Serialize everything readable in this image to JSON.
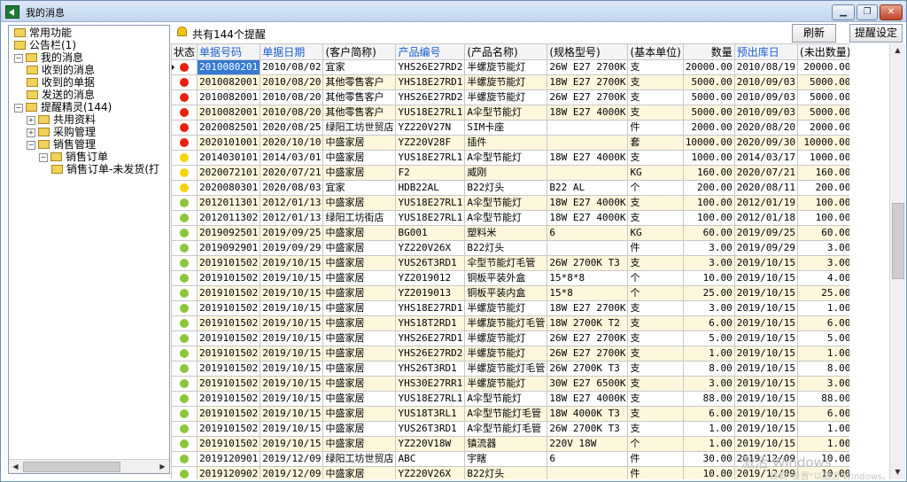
{
  "window": {
    "title": "我的消息",
    "minimize": "▁",
    "restore": "❐",
    "close": "✕"
  },
  "tree": {
    "nodes": [
      {
        "label": "常用功能",
        "level": 0,
        "expander": ""
      },
      {
        "label": "公告栏(1)",
        "level": 0,
        "expander": ""
      },
      {
        "label": "我的消息",
        "level": 0,
        "expander": "−"
      },
      {
        "label": "收到的消息",
        "level": 1,
        "expander": ""
      },
      {
        "label": "收到的单据",
        "level": 1,
        "expander": ""
      },
      {
        "label": "发送的消息",
        "level": 1,
        "expander": ""
      },
      {
        "label": "提醒精灵(144)",
        "level": 0,
        "expander": "−"
      },
      {
        "label": "共用资料",
        "level": 1,
        "expander": "+"
      },
      {
        "label": "采购管理",
        "level": 1,
        "expander": "+"
      },
      {
        "label": "销售管理",
        "level": 1,
        "expander": "−"
      },
      {
        "label": "销售订单",
        "level": 2,
        "expander": "−"
      },
      {
        "label": "销售订单-未发货(打",
        "level": 3,
        "expander": ""
      }
    ]
  },
  "toolbar": {
    "alert_count": "共有144个提醒",
    "refresh_label": "刷新",
    "settings_label": "提醒设定"
  },
  "table": {
    "headers": [
      "状态",
      "单据号码",
      "单据日期",
      "(客户简称)",
      "产品编号",
      "(产品名称)",
      "(规格型号)",
      "(基本单位)",
      "数量",
      "预出库日",
      "(未出数量)"
    ],
    "status_colors": {
      "red": "#e8200c",
      "yellow": "#f6d40c",
      "green": "#8cc63a"
    },
    "rows": [
      {
        "status": "red",
        "no": "2010080201",
        "date": "2010/08/02",
        "customer": "宜家",
        "code": "YHS26E27RD2",
        "name": "半螺旋节能灯",
        "spec": "26W E27 2700K",
        "unit": "支",
        "qty": "20000.00",
        "due": "2010/08/19",
        "pending": "20000.00"
      },
      {
        "status": "red",
        "no": "2010082001",
        "date": "2010/08/20",
        "customer": "其他零售客户",
        "code": "YHS18E27RD1",
        "name": "半螺旋节能灯",
        "spec": "18W E27 2700K",
        "unit": "支",
        "qty": "5000.00",
        "due": "2010/09/03",
        "pending": "5000.00"
      },
      {
        "status": "red",
        "no": "2010082001",
        "date": "2010/08/20",
        "customer": "其他零售客户",
        "code": "YHS26E27RD2",
        "name": "半螺旋节能灯",
        "spec": "26W E27 2700K",
        "unit": "支",
        "qty": "5000.00",
        "due": "2010/09/03",
        "pending": "5000.00"
      },
      {
        "status": "red",
        "no": "2010082001",
        "date": "2010/08/20",
        "customer": "其他零售客户",
        "code": "YUS18E27RL1",
        "name": "A伞型节能灯",
        "spec": "18W E27 4000K",
        "unit": "支",
        "qty": "5000.00",
        "due": "2010/09/03",
        "pending": "5000.00"
      },
      {
        "status": "red",
        "no": "2020082501",
        "date": "2020/08/25",
        "customer": "绿阳工坊世贸店",
        "code": "YZ220V27N",
        "name": "SIM卡座",
        "spec": "",
        "unit": "件",
        "qty": "2000.00",
        "due": "2020/08/20",
        "pending": "2000.00"
      },
      {
        "status": "red",
        "no": "2020101001",
        "date": "2020/10/10",
        "customer": "中盛家居",
        "code": "YZ220V28F",
        "name": "插件",
        "spec": "",
        "unit": "套",
        "qty": "10000.00",
        "due": "2020/09/30",
        "pending": "10000.00"
      },
      {
        "status": "yellow",
        "no": "2014030101",
        "date": "2014/03/01",
        "customer": "中盛家居",
        "code": "YUS18E27RL1",
        "name": "A伞型节能灯",
        "spec": "18W E27 4000K",
        "unit": "支",
        "qty": "1000.00",
        "due": "2014/03/17",
        "pending": "1000.00"
      },
      {
        "status": "yellow",
        "no": "2020072101",
        "date": "2020/07/21",
        "customer": "中盛家居",
        "code": "F2",
        "name": "威刚",
        "spec": "",
        "unit": "KG",
        "qty": "160.00",
        "due": "2020/07/21",
        "pending": "160.00"
      },
      {
        "status": "yellow",
        "no": "2020080301",
        "date": "2020/08/03",
        "customer": "宜家",
        "code": "HDB22AL",
        "name": "B22灯头",
        "spec": "B22 AL",
        "unit": "个",
        "qty": "200.00",
        "due": "2020/08/11",
        "pending": "200.00"
      },
      {
        "status": "green",
        "no": "2012011301",
        "date": "2012/01/13",
        "customer": "中盛家居",
        "code": "YUS18E27RL1",
        "name": "A伞型节能灯",
        "spec": "18W E27 4000K",
        "unit": "支",
        "qty": "100.00",
        "due": "2012/01/19",
        "pending": "100.00"
      },
      {
        "status": "green",
        "no": "2012011302",
        "date": "2012/01/13",
        "customer": "绿阳工坊街店",
        "code": "YUS18E27RL1",
        "name": "A伞型节能灯",
        "spec": "18W E27 4000K",
        "unit": "支",
        "qty": "100.00",
        "due": "2012/01/18",
        "pending": "100.00"
      },
      {
        "status": "green",
        "no": "2019092501",
        "date": "2019/09/25",
        "customer": "中盛家居",
        "code": "BG001",
        "name": "塑料米",
        "spec": "6",
        "unit": "KG",
        "qty": "60.00",
        "due": "2019/09/25",
        "pending": "60.00"
      },
      {
        "status": "green",
        "no": "2019092901",
        "date": "2019/09/29",
        "customer": "中盛家居",
        "code": "YZ220V26X",
        "name": "B22灯头",
        "spec": "",
        "unit": "件",
        "qty": "3.00",
        "due": "2019/09/29",
        "pending": "3.00"
      },
      {
        "status": "green",
        "no": "2019101502",
        "date": "2019/10/15",
        "customer": "中盛家居",
        "code": "YUS26T3RD1",
        "name": "伞型节能灯毛管",
        "spec": "26W 2700K T3",
        "unit": "支",
        "qty": "3.00",
        "due": "2019/10/15",
        "pending": "3.00"
      },
      {
        "status": "green",
        "no": "2019101502",
        "date": "2019/10/15",
        "customer": "中盛家居",
        "code": "YZ2019012",
        "name": "铜板平装外盒",
        "spec": "15*8*8",
        "unit": "个",
        "qty": "10.00",
        "due": "2019/10/15",
        "pending": "4.00"
      },
      {
        "status": "green",
        "no": "2019101502",
        "date": "2019/10/15",
        "customer": "中盛家居",
        "code": "YZ2019013",
        "name": "铜板平装内盒",
        "spec": "15*8",
        "unit": "个",
        "qty": "25.00",
        "due": "2019/10/15",
        "pending": "25.00"
      },
      {
        "status": "green",
        "no": "2019101502",
        "date": "2019/10/15",
        "customer": "中盛家居",
        "code": "YHS18E27RD1",
        "name": "半螺旋节能灯",
        "spec": "18W E27 2700K",
        "unit": "支",
        "qty": "3.00",
        "due": "2019/10/15",
        "pending": "1.00"
      },
      {
        "status": "green",
        "no": "2019101502",
        "date": "2019/10/15",
        "customer": "中盛家居",
        "code": "YHS18T2RD1",
        "name": "半螺旋节能灯毛管",
        "spec": "18W 2700K T2",
        "unit": "支",
        "qty": "6.00",
        "due": "2019/10/15",
        "pending": "6.00"
      },
      {
        "status": "green",
        "no": "2019101502",
        "date": "2019/10/15",
        "customer": "中盛家居",
        "code": "YHS26E27RD1",
        "name": "半螺旋节能灯",
        "spec": "26W E27 2700K",
        "unit": "支",
        "qty": "5.00",
        "due": "2019/10/15",
        "pending": "5.00"
      },
      {
        "status": "green",
        "no": "2019101502",
        "date": "2019/10/15",
        "customer": "中盛家居",
        "code": "YHS26E27RD2",
        "name": "半螺旋节能灯",
        "spec": "26W E27 2700K",
        "unit": "支",
        "qty": "1.00",
        "due": "2019/10/15",
        "pending": "1.00"
      },
      {
        "status": "green",
        "no": "2019101502",
        "date": "2019/10/15",
        "customer": "中盛家居",
        "code": "YHS26T3RD1",
        "name": "半螺旋节能灯毛管",
        "spec": "26W 2700K T3",
        "unit": "支",
        "qty": "8.00",
        "due": "2019/10/15",
        "pending": "8.00"
      },
      {
        "status": "green",
        "no": "2019101502",
        "date": "2019/10/15",
        "customer": "中盛家居",
        "code": "YHS30E27RR1",
        "name": "半螺旋节能灯",
        "spec": "30W E27 6500K",
        "unit": "支",
        "qty": "3.00",
        "due": "2019/10/15",
        "pending": "3.00"
      },
      {
        "status": "green",
        "no": "2019101502",
        "date": "2019/10/15",
        "customer": "中盛家居",
        "code": "YUS18E27RL1",
        "name": "A伞型节能灯",
        "spec": "18W E27 4000K",
        "unit": "支",
        "qty": "88.00",
        "due": "2019/10/15",
        "pending": "88.00"
      },
      {
        "status": "green",
        "no": "2019101502",
        "date": "2019/10/15",
        "customer": "中盛家居",
        "code": "YUS18T3RL1",
        "name": "A伞型节能灯毛管",
        "spec": "18W 4000K T3",
        "unit": "支",
        "qty": "6.00",
        "due": "2019/10/15",
        "pending": "6.00"
      },
      {
        "status": "green",
        "no": "2019101502",
        "date": "2019/10/15",
        "customer": "中盛家居",
        "code": "YUS26T3RD1",
        "name": "A伞型节能灯毛管",
        "spec": "26W 2700K T3",
        "unit": "支",
        "qty": "1.00",
        "due": "2019/10/15",
        "pending": "1.00"
      },
      {
        "status": "green",
        "no": "2019101502",
        "date": "2019/10/15",
        "customer": "中盛家居",
        "code": "YZ220V18W",
        "name": "镇流器",
        "spec": "220V 18W",
        "unit": "个",
        "qty": "1.00",
        "due": "2019/10/15",
        "pending": "1.00"
      },
      {
        "status": "green",
        "no": "2019120901",
        "date": "2019/12/09",
        "customer": "绿阳工坊世贸店",
        "code": "ABC",
        "name": "宇瞎",
        "spec": "6",
        "unit": "件",
        "qty": "30.00",
        "due": "2019/12/09",
        "pending": "10.00"
      },
      {
        "status": "green",
        "no": "2019120902",
        "date": "2019/12/09",
        "customer": "中盛家居",
        "code": "YZ220V26X",
        "name": "B22灯头",
        "spec": "",
        "unit": "件",
        "qty": "10.00",
        "due": "2019/12/09",
        "pending": "10.00"
      }
    ]
  },
  "watermark": {
    "line1": "激活 Windows",
    "line2": "转到\"设置\"以激活 Windows。"
  }
}
